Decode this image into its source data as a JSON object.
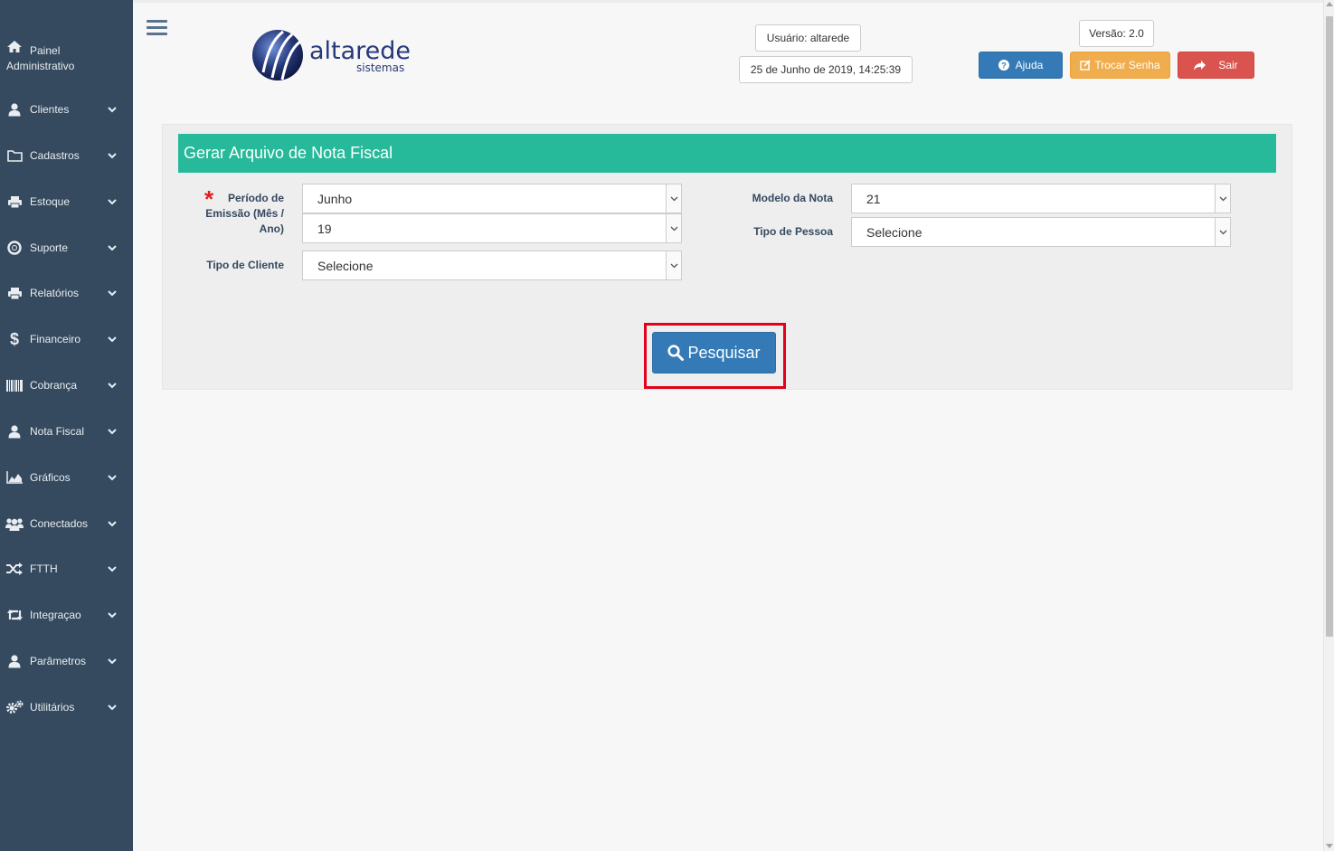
{
  "sidebar": {
    "title_line1": "Painel",
    "title_line2": "Administrativo",
    "items": [
      {
        "label": "Clientes",
        "icon": "user-icon"
      },
      {
        "label": "Cadastros",
        "icon": "folder-icon"
      },
      {
        "label": "Estoque",
        "icon": "printer-icon"
      },
      {
        "label": "Suporte",
        "icon": "lifebuoy-icon"
      },
      {
        "label": "Relatórios",
        "icon": "printer-icon"
      },
      {
        "label": "Financeiro",
        "icon": "dollar-icon"
      },
      {
        "label": "Cobrança",
        "icon": "barcode-icon"
      },
      {
        "label": "Nota Fiscal",
        "icon": "user-icon"
      },
      {
        "label": "Gráficos",
        "icon": "area-chart-icon"
      },
      {
        "label": "Conectados",
        "icon": "users-icon"
      },
      {
        "label": "FTTH",
        "icon": "shuffle-icon"
      },
      {
        "label": "Integraçao",
        "icon": "retweet-icon"
      },
      {
        "label": "Parâmetros",
        "icon": "user-icon"
      },
      {
        "label": "Utilitários",
        "icon": "cogs-icon"
      }
    ]
  },
  "header": {
    "logo_main": "altarede",
    "logo_sub": "sistemas",
    "user": "Usuário: altarede",
    "datetime": "25 de Junho de 2019, 14:25:39",
    "version": "Versão: 2.0",
    "help_label": "Ajuda",
    "change_password_label": "Trocar Senha",
    "exit_label": "Sair"
  },
  "form": {
    "title": "Gerar Arquivo de Nota Fiscal",
    "required_mark": "*",
    "periodo_label": "Período de Emissão (Mês / Ano)",
    "periodo_label_l1": "Período de",
    "periodo_label_l2": "Emissão (Mês /",
    "periodo_label_l3": "Ano)",
    "mes_value": "Junho",
    "ano_value": "19",
    "tipo_cliente_label": "Tipo de Cliente",
    "tipo_cliente_value": "Selecione",
    "modelo_label": "Modelo da Nota",
    "modelo_value": "21",
    "tipo_pessoa_label": "Tipo de Pessoa",
    "tipo_pessoa_value": "Selecione",
    "search_label": "Pesquisar"
  },
  "colors": {
    "sidebar_bg": "#354a5f",
    "header_green": "#26b99a",
    "primary": "#337ab7",
    "warning": "#f0ad4e",
    "danger": "#d9534f",
    "highlight": "#e3001b"
  }
}
